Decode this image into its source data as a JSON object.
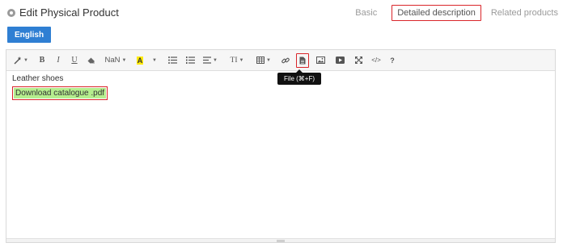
{
  "header": {
    "title": "Edit Physical Product",
    "tabs": [
      {
        "label": "Basic"
      },
      {
        "label": "Detailed description"
      },
      {
        "label": "Related products"
      }
    ]
  },
  "language_button": "English",
  "toolbar": {
    "font_family": "NaN",
    "bold": "B",
    "italic": "I",
    "underline": "U",
    "text_size": "TI",
    "help": "?",
    "code": "</>",
    "tooltip": "File (⌘+F)"
  },
  "editor": {
    "line1": "Leather shoes",
    "link_text": "Download catalogue .pdf"
  },
  "colors": {
    "accent": "#2f7fd3",
    "highlight_red": "#d9252a",
    "link_bg": "#b5ee8e"
  }
}
